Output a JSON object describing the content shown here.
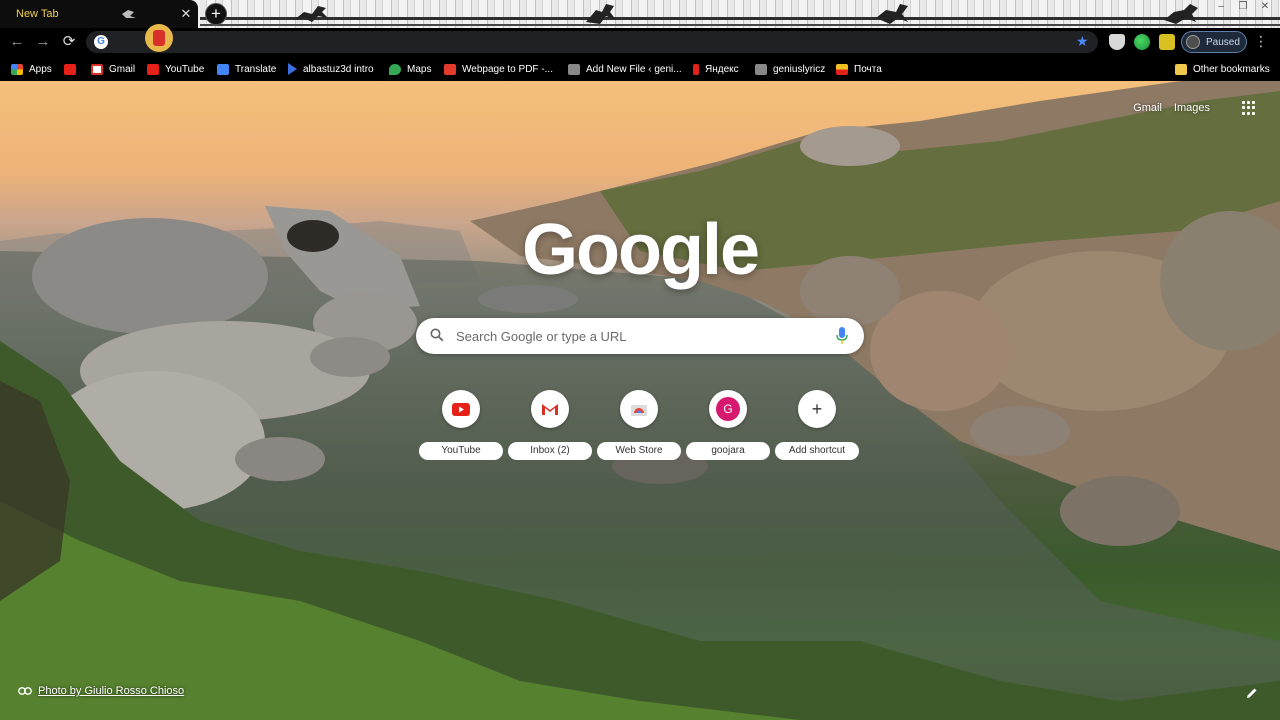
{
  "tab": {
    "title": "New Tab",
    "close_glyph": "✕",
    "new_tab_glyph": "+"
  },
  "window_controls": [
    "–",
    "❐",
    "✕"
  ],
  "toolbar": {
    "back_glyph": "←",
    "forward_glyph": "→",
    "reload_glyph": "⟳",
    "omnibox_icon": "G",
    "star_glyph": "★",
    "profile_status": "Paused",
    "menu_glyph": "⋮"
  },
  "bookmarks": [
    {
      "label": "Apps",
      "icon": "apps-icon",
      "color": "#4a8af4"
    },
    {
      "label": "",
      "icon": "youtube-icon",
      "color": "#e62117"
    },
    {
      "label": "Gmail",
      "icon": "gmail-icon",
      "color": "#d93025"
    },
    {
      "label": "YouTube",
      "icon": "youtube-icon",
      "color": "#e62117"
    },
    {
      "label": "Translate",
      "icon": "translate-icon",
      "color": "#4285f4"
    },
    {
      "label": "albastuz3d intro",
      "icon": "play-icon",
      "color": "#3b6fe0"
    },
    {
      "label": "Maps",
      "icon": "maps-icon",
      "color": "#34a853"
    },
    {
      "label": "Webpage to PDF -...",
      "icon": "pdf-icon",
      "color": "#e23b2e"
    },
    {
      "label": "Add New File ‹ geni...",
      "icon": "wordpress-icon",
      "color": "#888888"
    },
    {
      "label": "Яндекс",
      "icon": "yandex-icon",
      "color": "#e2231a"
    },
    {
      "label": "geniuslyricz",
      "icon": "wordpress-icon",
      "color": "#888888"
    },
    {
      "label": "Почта",
      "icon": "mail-icon",
      "color": "#f0c020"
    }
  ],
  "other_bookmarks": "Other bookmarks",
  "header_links": {
    "gmail": "Gmail",
    "images": "Images"
  },
  "logo": "Google",
  "search": {
    "placeholder": "Search Google or type a URL"
  },
  "shortcuts": [
    {
      "label": "YouTube",
      "icon": "youtube-icon",
      "color": "#e62117"
    },
    {
      "label": "Inbox (2)",
      "icon": "gmail-icon",
      "color": "#d93025"
    },
    {
      "label": "Web Store",
      "icon": "webstore-icon",
      "color": "#4285f4"
    },
    {
      "label": "goojara",
      "icon": "letter-g-icon",
      "letter": "G",
      "color": "#d6186e"
    },
    {
      "label": "Add shortcut",
      "icon": "plus-icon",
      "glyph": "+",
      "color": "#333333"
    }
  ],
  "photo_credit": "Photo by Giulio Rosso Chioso",
  "colors": {
    "tab_title": "#f0d050",
    "accent": "#4a8af4",
    "frame": "#000000"
  }
}
